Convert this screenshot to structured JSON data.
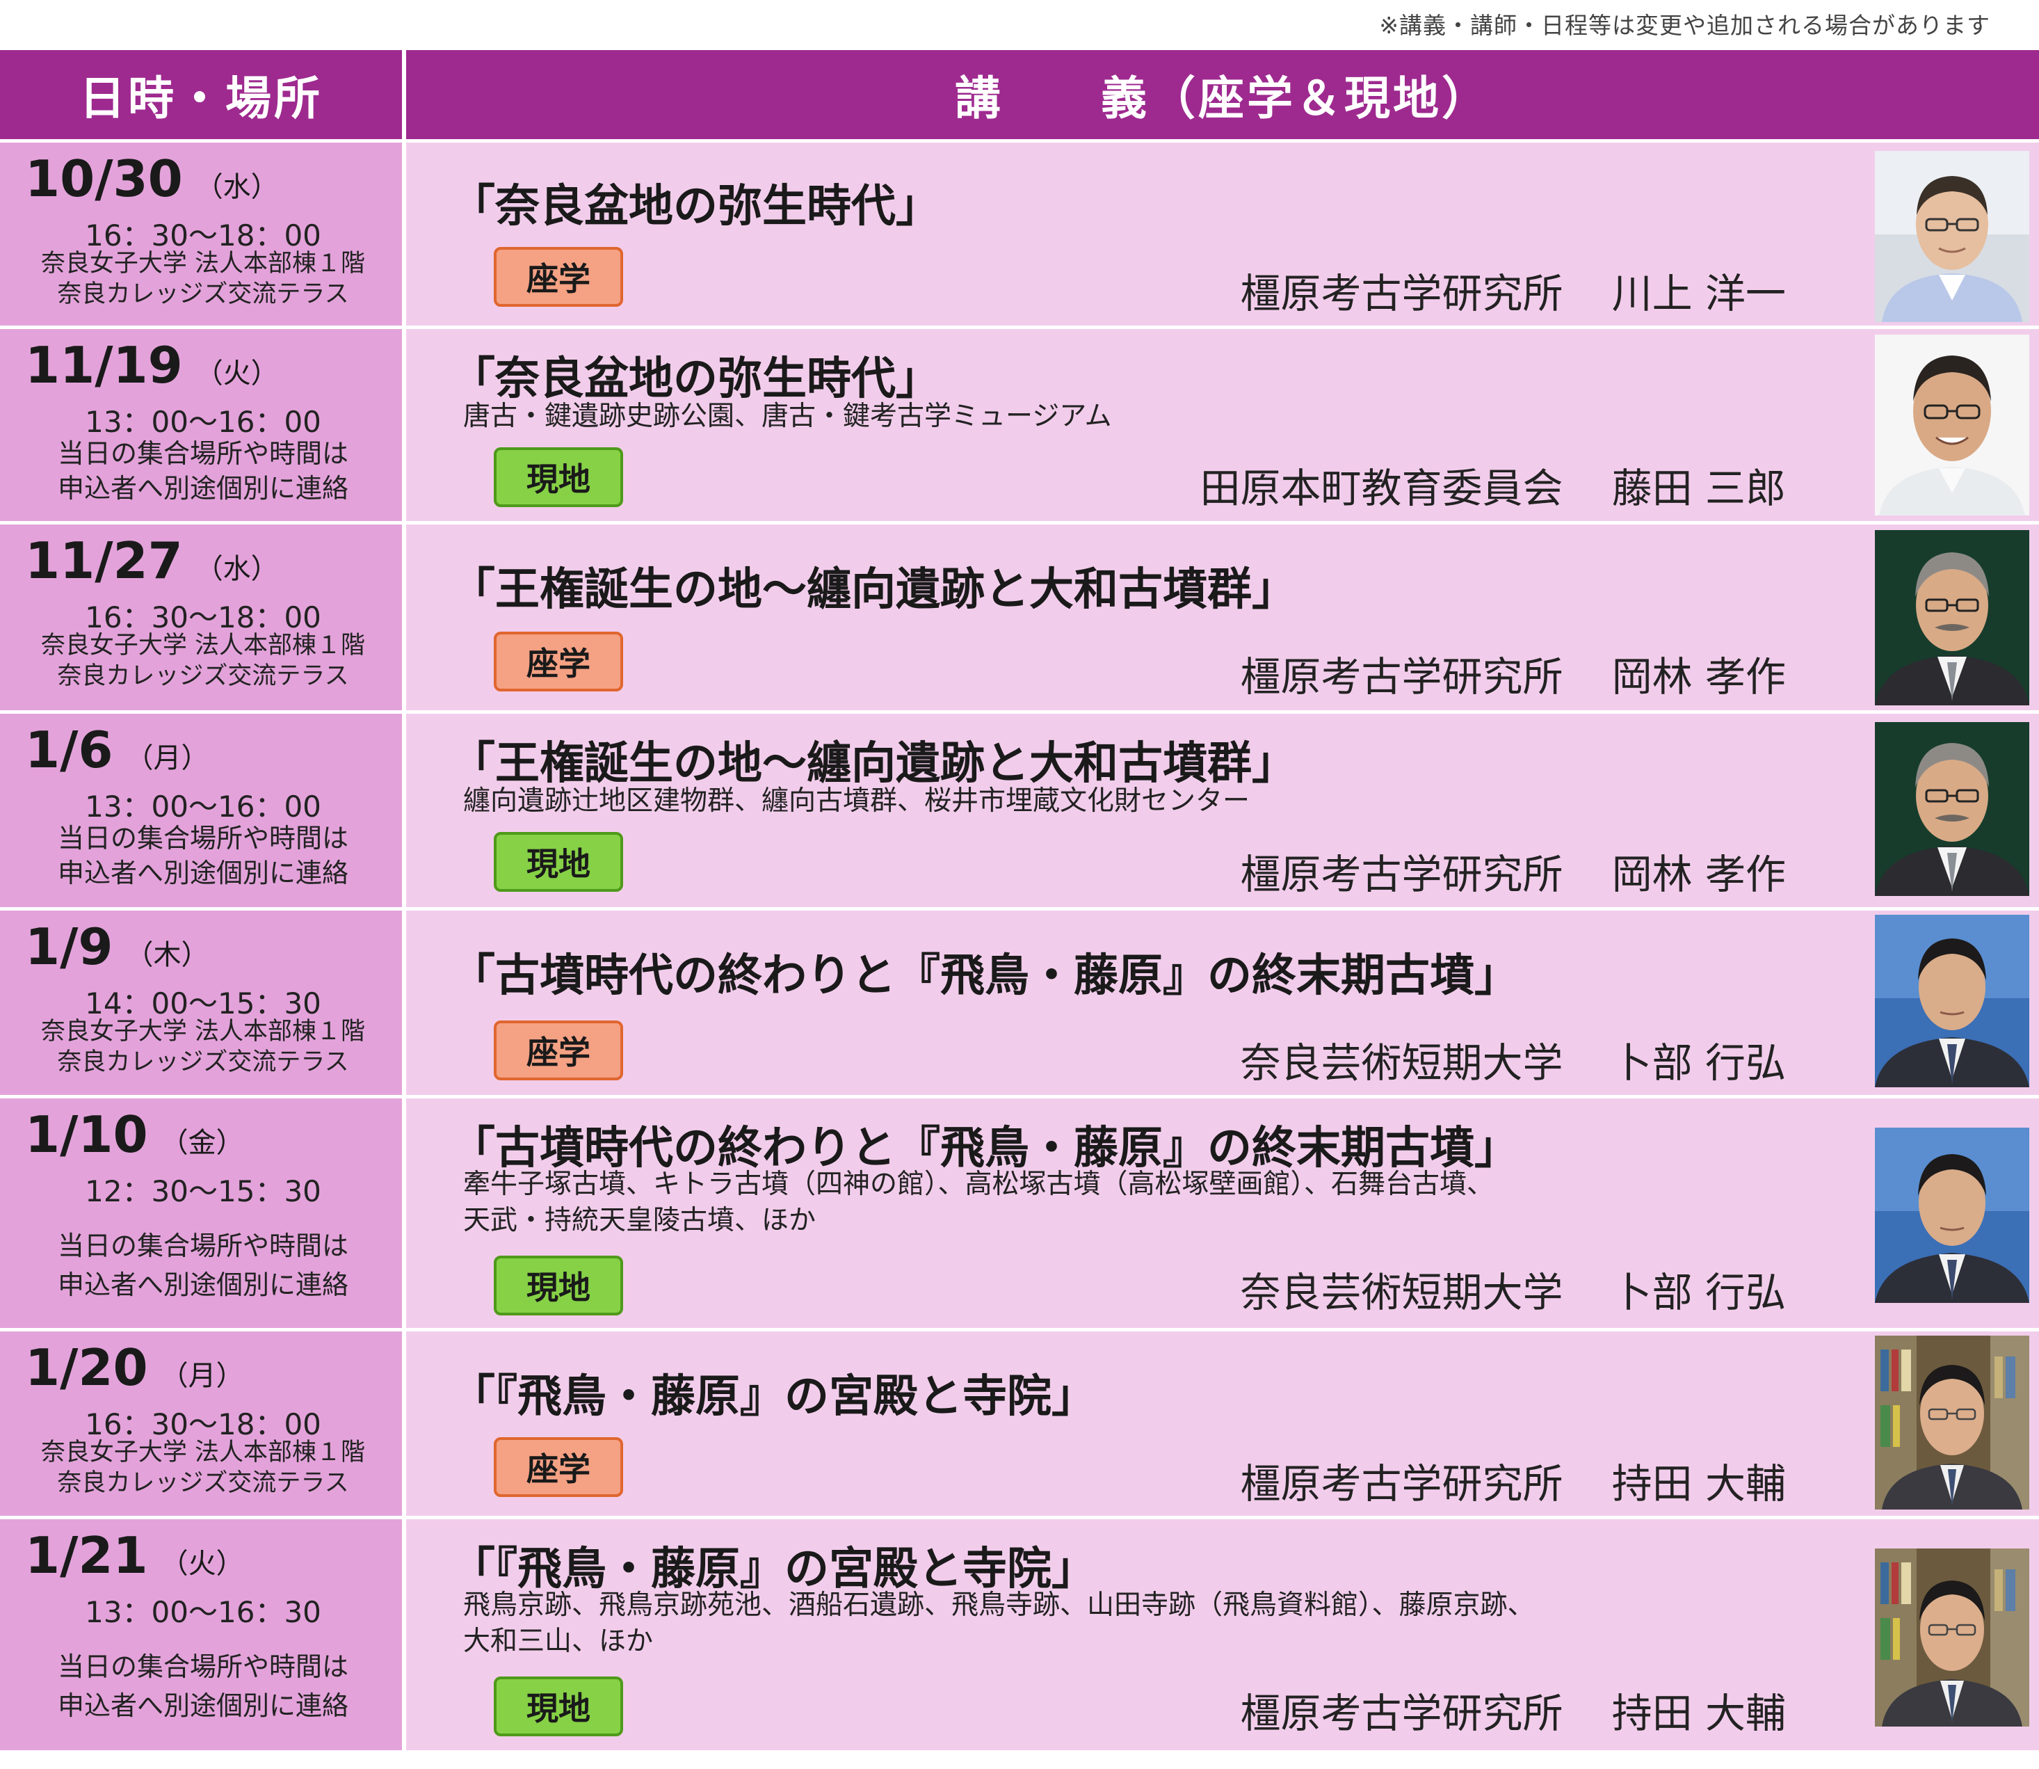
{
  "note": "※講義・講師・日程等は変更や追加される場合があります",
  "header": {
    "col1": "日時・場所",
    "col2": "講　　義（座学＆現地）"
  },
  "rows": [
    {
      "date": "10/30",
      "dow": "（水）",
      "time": "16：30〜18：00",
      "loc1": "奈良女子大学 法人本部棟１階",
      "loc2": "奈良カレッジズ交流テラス",
      "title": "「奈良盆地の弥生時代」",
      "sites1": "",
      "sites2": "",
      "badge": "座学",
      "org": "橿原考古学研究所",
      "name": "川上 洋一"
    },
    {
      "date": "11/19",
      "dow": "（火）",
      "time": "13：00〜16：00",
      "loc1": "当日の集合場所や時間は",
      "loc2": "申込者へ別途個別に連絡",
      "title": "「奈良盆地の弥生時代」",
      "sites1": "唐古・鍵遺跡史跡公園、唐古・鍵考古学ミュージアム",
      "sites2": "",
      "badge": "現地",
      "org": "田原本町教育委員会",
      "name": "藤田 三郎"
    },
    {
      "date": "11/27",
      "dow": "（水）",
      "time": "16：30〜18：00",
      "loc1": "奈良女子大学 法人本部棟１階",
      "loc2": "奈良カレッジズ交流テラス",
      "title": "「王権誕生の地〜纏向遺跡と大和古墳群」",
      "sites1": "",
      "sites2": "",
      "badge": "座学",
      "org": "橿原考古学研究所",
      "name": "岡林 孝作"
    },
    {
      "date": "1/6",
      "dow": "（月）",
      "time": "13：00〜16：00",
      "loc1": "当日の集合場所や時間は",
      "loc2": "申込者へ別途個別に連絡",
      "title": "「王権誕生の地〜纏向遺跡と大和古墳群」",
      "sites1": "纏向遺跡辻地区建物群、纏向古墳群、桜井市埋蔵文化財センター",
      "sites2": "",
      "badge": "現地",
      "org": "橿原考古学研究所",
      "name": "岡林 孝作"
    },
    {
      "date": "1/9",
      "dow": "（木）",
      "time": "14：00〜15：30",
      "loc1": "奈良女子大学 法人本部棟１階",
      "loc2": "奈良カレッジズ交流テラス",
      "title": "「古墳時代の終わりと『飛鳥・藤原』の終末期古墳」",
      "sites1": "",
      "sites2": "",
      "badge": "座学",
      "org": "奈良芸術短期大学",
      "name": "卜部 行弘"
    },
    {
      "date": "1/10",
      "dow": "（金）",
      "time": "12：30〜15：30",
      "loc1": "当日の集合場所や時間は",
      "loc2": "申込者へ別途個別に連絡",
      "title": "「古墳時代の終わりと『飛鳥・藤原』の終末期古墳」",
      "sites1": "牽牛子塚古墳、キトラ古墳（四神の館）、高松塚古墳（高松塚壁画館）、石舞台古墳、",
      "sites2": "天武・持統天皇陵古墳、ほか",
      "badge": "現地",
      "org": "奈良芸術短期大学",
      "name": "卜部 行弘"
    },
    {
      "date": "1/20",
      "dow": "（月）",
      "time": "16：30〜18：00",
      "loc1": "奈良女子大学 法人本部棟１階",
      "loc2": "奈良カレッジズ交流テラス",
      "title": "「『飛鳥・藤原』の宮殿と寺院」",
      "sites1": "",
      "sites2": "",
      "badge": "座学",
      "org": "橿原考古学研究所",
      "name": "持田 大輔"
    },
    {
      "date": "1/21",
      "dow": "（火）",
      "time": "13：00〜16：30",
      "loc1": "当日の集合場所や時間は",
      "loc2": "申込者へ別途個別に連絡",
      "title": "「『飛鳥・藤原』の宮殿と寺院」",
      "sites1": "飛鳥京跡、飛鳥京跡苑池、酒船石遺跡、飛鳥寺跡、山田寺跡（飛鳥資料館）、藤原京跡、",
      "sites2": "大和三山、ほか",
      "badge": "現地",
      "org": "橿原考古学研究所",
      "name": "持田 大輔"
    }
  ]
}
